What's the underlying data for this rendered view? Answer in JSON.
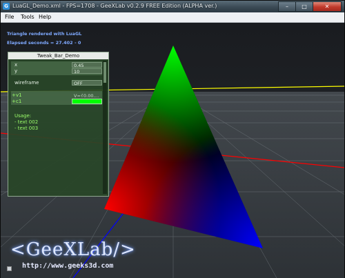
{
  "window": {
    "title": "LuaGL_Demo.xml - FPS=1708 - GeeXLab v0.2.9 FREE Edition (ALPHA ver.)",
    "icon": "app-icon",
    "buttons": [
      "minimize-icon",
      "maximize-icon",
      "close-icon"
    ]
  },
  "menubar": {
    "file": "File",
    "tools": "Tools",
    "help": "Help"
  },
  "overlay": {
    "line1": "Triangle rendered with LuaGL",
    "line2": "Elapsed seconds = 27.402 - 0"
  },
  "tweakbar": {
    "title": "Tweak_Bar_Demo",
    "x_label": "x",
    "x_value": "0.45",
    "y_label": "y",
    "y_value": "10",
    "wireframe_label": "wireframe",
    "wireframe_value": "OFF",
    "v1_label": "v1",
    "v1_value": "V={0.00,...",
    "c1_label": "c1",
    "c1_color": "#00ff00",
    "usage_label": "Usage:",
    "usage_items": [
      "- text 002",
      "- text 003"
    ]
  },
  "branding": {
    "logo": "<GeeXLab/>",
    "url": "http://www.geeks3d.com"
  },
  "colors": {
    "accent": "#7fa9ff",
    "grid_x_axis": "#ff0000",
    "grid_z_axis": "#ffff00",
    "grid_y_axis": "#0000ff"
  }
}
